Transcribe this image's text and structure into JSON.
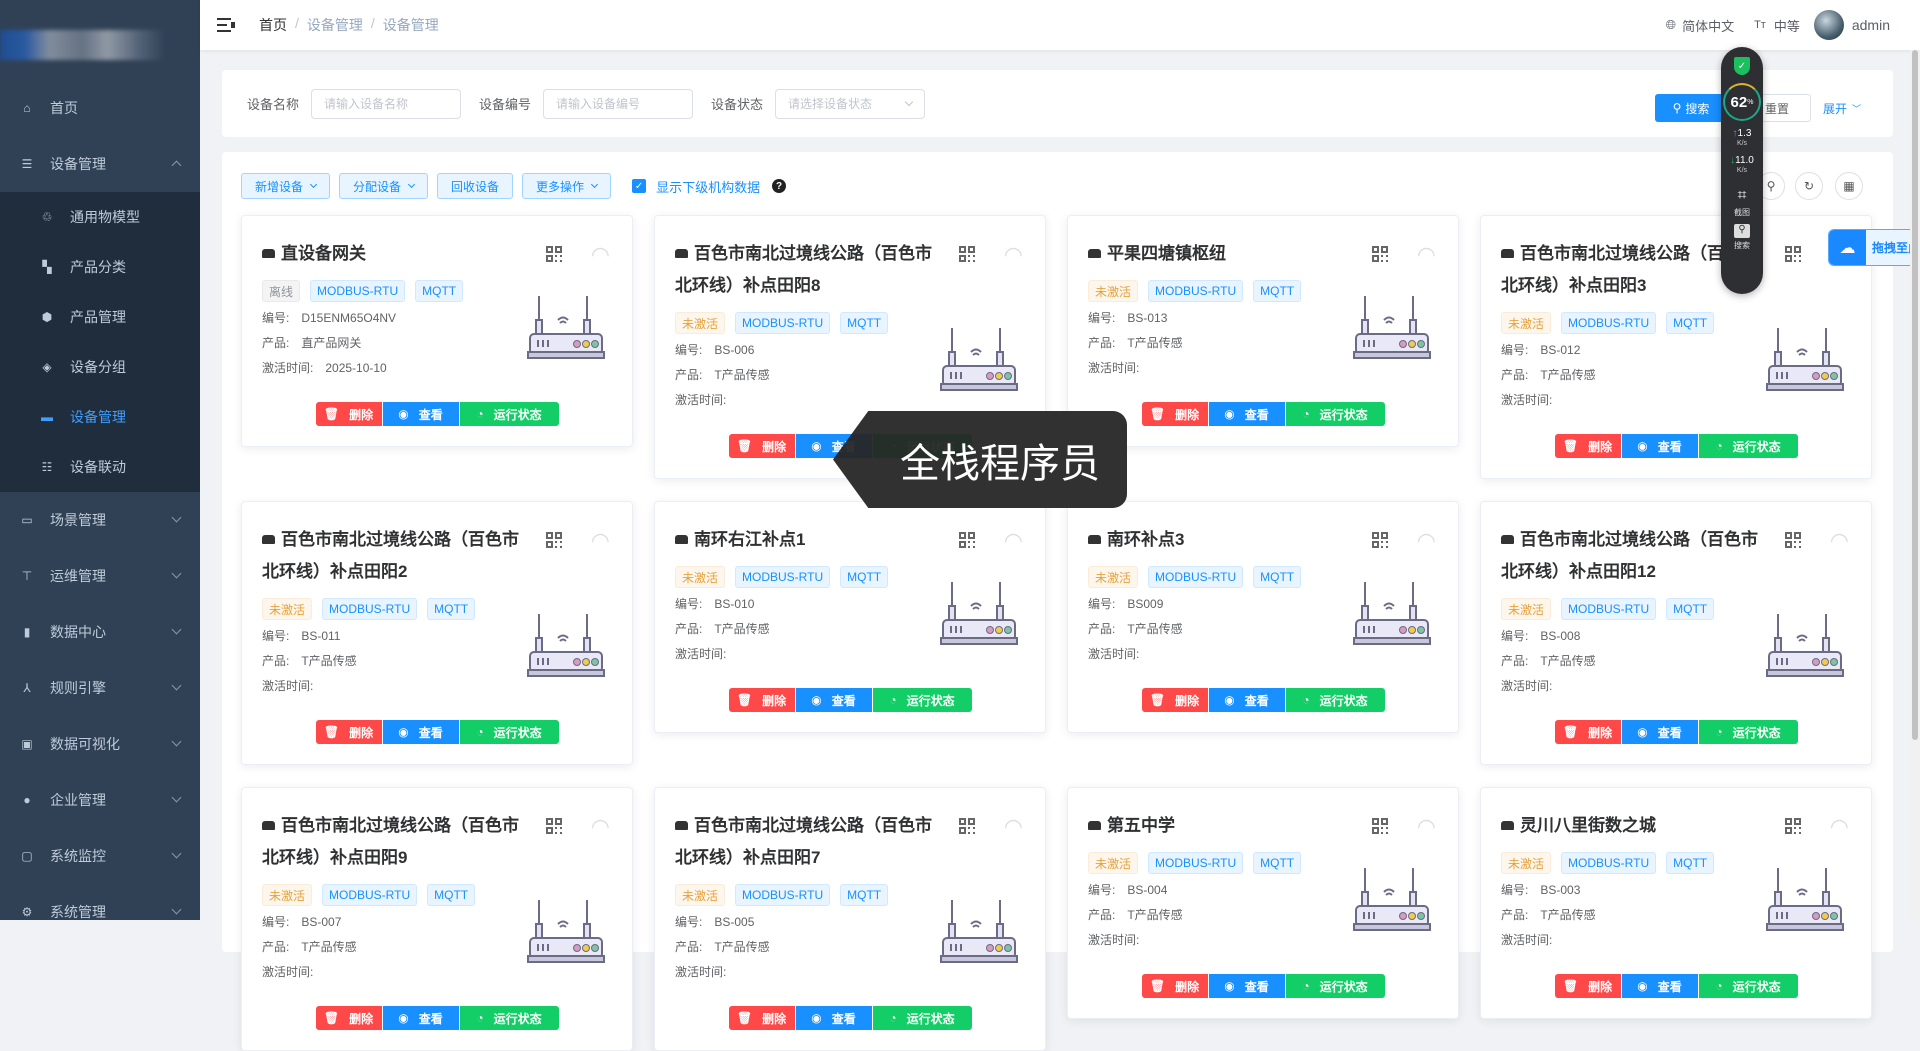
{
  "header": {
    "breadcrumb": [
      "首页",
      "设备管理",
      "设备管理"
    ],
    "language": "简体中文",
    "size": "中等",
    "user": "admin"
  },
  "sidebar": {
    "items": [
      {
        "label": "首页",
        "icon": "home-icon",
        "expanded": null
      },
      {
        "label": "设备管理",
        "icon": "server-icon",
        "expanded": true,
        "children": [
          {
            "label": "通用物模型",
            "icon": "model-icon"
          },
          {
            "label": "产品分类",
            "icon": "category-icon"
          },
          {
            "label": "产品管理",
            "icon": "box-icon"
          },
          {
            "label": "设备分组",
            "icon": "layers-icon"
          },
          {
            "label": "设备管理",
            "icon": "device-icon",
            "active": true
          },
          {
            "label": "设备联动",
            "icon": "linkage-icon"
          }
        ]
      },
      {
        "label": "场景管理",
        "icon": "scene-icon",
        "expanded": false
      },
      {
        "label": "运维管理",
        "icon": "ops-icon",
        "expanded": false
      },
      {
        "label": "数据中心",
        "icon": "chart-icon",
        "expanded": false
      },
      {
        "label": "规则引擎",
        "icon": "rule-icon",
        "expanded": false
      },
      {
        "label": "数据可视化",
        "icon": "monitor-icon",
        "expanded": false
      },
      {
        "label": "企业管理",
        "icon": "enterprise-icon",
        "expanded": false
      },
      {
        "label": "系统监控",
        "icon": "pulse-icon",
        "expanded": false
      },
      {
        "label": "系统管理",
        "icon": "gear-icon",
        "expanded": false
      }
    ]
  },
  "search": {
    "fields": [
      {
        "label": "设备名称",
        "placeholder": "请输入设备名称"
      },
      {
        "label": "设备编号",
        "placeholder": "请输入设备编号"
      },
      {
        "label": "设备状态",
        "placeholder": "请选择设备状态"
      }
    ],
    "search_label": "搜索",
    "reset_label": "重置",
    "expand_label": "展开"
  },
  "toolbar": {
    "add": "新增设备",
    "assign": "分配设备",
    "recycle": "回收设备",
    "more": "更多操作",
    "show_sub": "显示下级机构数据",
    "show_sub_checked": true
  },
  "card_labels": {
    "code": "编号:",
    "product": "产品:",
    "activated": "激活时间:",
    "delete": "删除",
    "view": "查看",
    "status": "运行状态"
  },
  "devices": [
    {
      "name": "直设备网关",
      "status": "离线",
      "tags": [
        "MODBUS-RTU",
        "MQTT"
      ],
      "code": "D15ENM65O4NV",
      "product": "直产品网关",
      "activated": "2025-10-10"
    },
    {
      "name": "百色市南北过境线公路（百色市北环线）补点田阳8",
      "status": "未激活",
      "tags": [
        "MODBUS-RTU",
        "MQTT"
      ],
      "code": "BS-006",
      "product": "T产品传感",
      "activated": ""
    },
    {
      "name": "平果四塘镇枢纽",
      "status": "未激活",
      "tags": [
        "MODBUS-RTU",
        "MQTT"
      ],
      "code": "BS-013",
      "product": "T产品传感",
      "activated": ""
    },
    {
      "name": "百色市南北过境线公路（百色市北环线）补点田阳3",
      "status": "未激活",
      "tags": [
        "MODBUS-RTU",
        "MQTT"
      ],
      "code": "BS-012",
      "product": "T产品传感",
      "activated": ""
    },
    {
      "name": "百色市南北过境线公路（百色市北环线）补点田阳2",
      "status": "未激活",
      "tags": [
        "MODBUS-RTU",
        "MQTT"
      ],
      "code": "BS-011",
      "product": "T产品传感",
      "activated": ""
    },
    {
      "name": "南环右江补点1",
      "status": "未激活",
      "tags": [
        "MODBUS-RTU",
        "MQTT"
      ],
      "code": "BS-010",
      "product": "T产品传感",
      "activated": ""
    },
    {
      "name": "南环补点3",
      "status": "未激活",
      "tags": [
        "MODBUS-RTU",
        "MQTT"
      ],
      "code": "BS009",
      "product": "T产品传感",
      "activated": ""
    },
    {
      "name": "百色市南北过境线公路（百色市北环线）补点田阳12",
      "status": "未激活",
      "tags": [
        "MODBUS-RTU",
        "MQTT"
      ],
      "code": "BS-008",
      "product": "T产品传感",
      "activated": ""
    },
    {
      "name": "百色市南北过境线公路（百色市北环线）补点田阳9",
      "status": "未激活",
      "tags": [
        "MODBUS-RTU",
        "MQTT"
      ],
      "code": "BS-007",
      "product": "T产品传感",
      "activated": ""
    },
    {
      "name": "百色市南北过境线公路（百色市北环线）补点田阳7",
      "status": "未激活",
      "tags": [
        "MODBUS-RTU",
        "MQTT"
      ],
      "code": "BS-005",
      "product": "T产品传感",
      "activated": ""
    },
    {
      "name": "第五中学",
      "status": "未激活",
      "tags": [
        "MODBUS-RTU",
        "MQTT"
      ],
      "code": "BS-004",
      "product": "T产品传感",
      "activated": ""
    },
    {
      "name": "灵川八里街数之城",
      "status": "未激活",
      "tags": [
        "MODBUS-RTU",
        "MQTT"
      ],
      "code": "BS-003",
      "product": "T产品传感",
      "activated": ""
    }
  ],
  "widget": {
    "percent": "62",
    "percent_unit": "%",
    "up": "1.3",
    "down": "11.0",
    "speed_unit": "K/s",
    "screenshot": "截图",
    "search": "搜索"
  },
  "baidu": {
    "label": "拖拽至此"
  },
  "watermark": "全栈程序员",
  "colors": {
    "sidebar": "#304156",
    "submenu": "#1f2d3d",
    "primary": "#1890ff",
    "danger": "#ff4949",
    "success": "#13ce66",
    "warning": "#e6a23c"
  }
}
